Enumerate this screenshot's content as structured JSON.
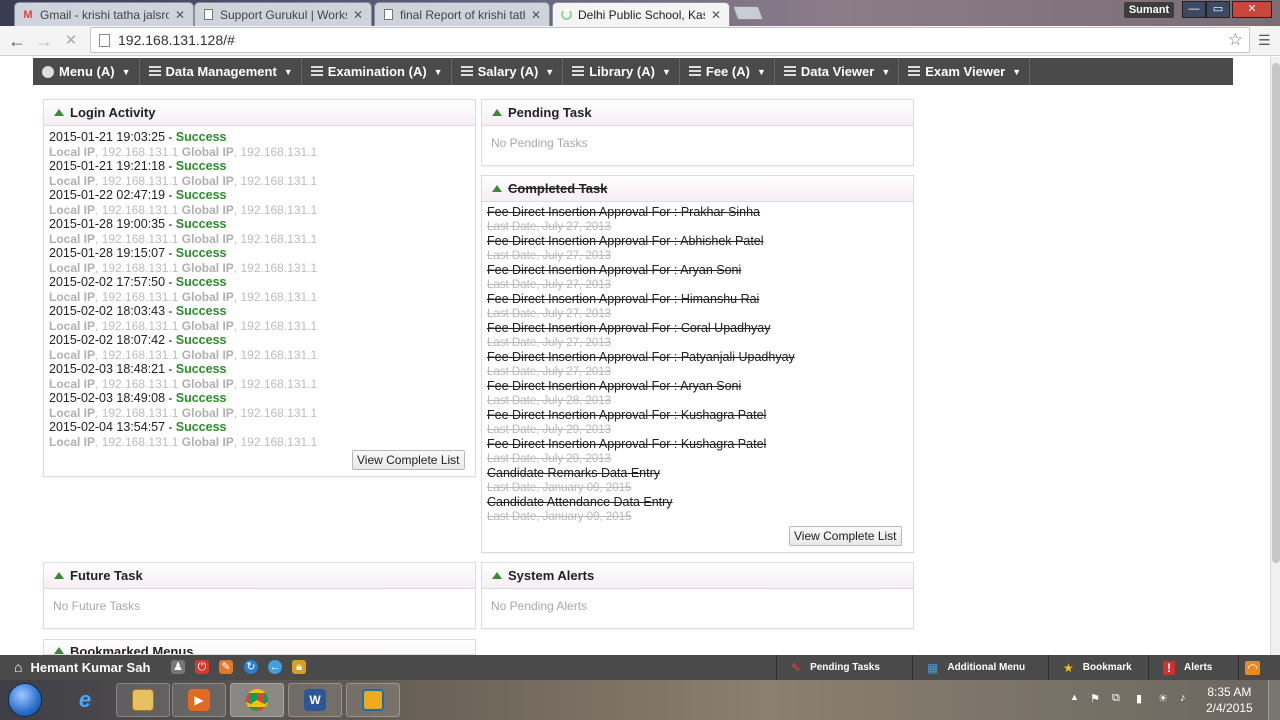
{
  "browser": {
    "tabs": [
      {
        "title": "Gmail - krishi tatha jalsrot",
        "icon": "gmail-icon",
        "active": false
      },
      {
        "title": "Support Gurukul | Worksh",
        "icon": "page-icon",
        "active": false
      },
      {
        "title": "final Report of krishi tatha",
        "icon": "page-icon",
        "active": false
      },
      {
        "title": "Delhi Public School, Kashi",
        "icon": "loading-icon",
        "active": true
      }
    ],
    "profile_name": "Sumant",
    "url": "192.168.131.128/#"
  },
  "nav": {
    "items": [
      {
        "label": "Menu (A)"
      },
      {
        "label": "Data Management"
      },
      {
        "label": "Examination (A)"
      },
      {
        "label": "Salary (A)"
      },
      {
        "label": "Library (A)"
      },
      {
        "label": "Fee (A)"
      },
      {
        "label": "Data Viewer"
      },
      {
        "label": "Exam Viewer"
      }
    ]
  },
  "login_activity": {
    "title": "Login Activity",
    "separator": " - ",
    "local_label": "Local IP",
    "global_label": "Global IP",
    "entries": [
      {
        "time": "2015-01-21 19:03:25",
        "status": "Success",
        "local_ip": "192.168.131.1",
        "global_ip": "192.168.131.1"
      },
      {
        "time": "2015-01-21 19:21:18",
        "status": "Success",
        "local_ip": "192.168.131.1",
        "global_ip": "192.168.131.1"
      },
      {
        "time": "2015-01-22 02:47:19",
        "status": "Success",
        "local_ip": "192.168.131.1",
        "global_ip": "192.168.131.1"
      },
      {
        "time": "2015-01-28 19:00:35",
        "status": "Success",
        "local_ip": "192.168.131.1",
        "global_ip": "192.168.131.1"
      },
      {
        "time": "2015-01-28 19:15:07",
        "status": "Success",
        "local_ip": "192.168.131.1",
        "global_ip": "192.168.131.1"
      },
      {
        "time": "2015-02-02 17:57:50",
        "status": "Success",
        "local_ip": "192.168.131.1",
        "global_ip": "192.168.131.1"
      },
      {
        "time": "2015-02-02 18:03:43",
        "status": "Success",
        "local_ip": "192.168.131.1",
        "global_ip": "192.168.131.1"
      },
      {
        "time": "2015-02-02 18:07:42",
        "status": "Success",
        "local_ip": "192.168.131.1",
        "global_ip": "192.168.131.1"
      },
      {
        "time": "2015-02-03 18:48:21",
        "status": "Success",
        "local_ip": "192.168.131.1",
        "global_ip": "192.168.131.1"
      },
      {
        "time": "2015-02-03 18:49:08",
        "status": "Success",
        "local_ip": "192.168.131.1",
        "global_ip": "192.168.131.1"
      },
      {
        "time": "2015-02-04 13:54:57",
        "status": "Success",
        "local_ip": "192.168.131.1",
        "global_ip": "192.168.131.1"
      }
    ],
    "view_all_label": "View Complete List"
  },
  "pending_task": {
    "title": "Pending Task",
    "empty_text": "No Pending Tasks"
  },
  "completed_task": {
    "title": "Completed Task",
    "entries": [
      {
        "name": "Fee Direct Insertion Approval For : Prakhar Sinha",
        "date": "Last Date, July 27, 2013"
      },
      {
        "name": "Fee Direct Insertion Approval For : Abhishek Patel",
        "date": "Last Date, July 27, 2013"
      },
      {
        "name": "Fee Direct Insertion Approval For : Aryan Soni",
        "date": "Last Date, July 27, 2013"
      },
      {
        "name": "Fee Direct Insertion Approval For : Himanshu Rai",
        "date": "Last Date, July 27, 2013"
      },
      {
        "name": "Fee Direct Insertion Approval For : Coral Upadhyay",
        "date": "Last Date, July 27, 2013"
      },
      {
        "name": "Fee Direct Insertion Approval For : Patyanjali Upadhyay",
        "date": "Last Date, July 27, 2013"
      },
      {
        "name": "Fee Direct Insertion Approval For : Aryan Soni",
        "date": "Last Date, July 28, 2013"
      },
      {
        "name": "Fee Direct Insertion Approval For : Kushagra Patel",
        "date": "Last Date, July 29, 2013"
      },
      {
        "name": "Fee Direct Insertion Approval For : Kushagra Patel",
        "date": "Last Date, July 29, 2013"
      },
      {
        "name": "Candidate Remarks Data Entry",
        "date": "Last Date, January 09, 2015"
      },
      {
        "name": "Candidate Attendance Data Entry",
        "date": "Last Date, January 09, 2015"
      }
    ],
    "view_all_label": "View Complete List"
  },
  "future_task": {
    "title": "Future Task",
    "empty_text": "No Future Tasks"
  },
  "system_alerts": {
    "title": "System Alerts",
    "empty_text": "No Pending Alerts"
  },
  "bookmarked_menus": {
    "title": "Bookmarked Menus"
  },
  "statusbar": {
    "user_name": "Hemant Kumar Sah",
    "buttons": [
      {
        "label": "Pending Tasks",
        "icon": "pen-icon"
      },
      {
        "label": "Additional Menu",
        "icon": "grid-icon"
      },
      {
        "label": "Bookmark",
        "icon": "star-icon"
      },
      {
        "label": "Alerts",
        "icon": "alert-icon"
      }
    ]
  },
  "taskbar": {
    "time": "8:35 AM",
    "date": "2/4/2015"
  },
  "colors": {
    "nav_bg": "#4a4a4a",
    "success": "#2e8b2e",
    "panel_head_tint": "#f6eef4",
    "triangle": "#3a8a3a"
  }
}
